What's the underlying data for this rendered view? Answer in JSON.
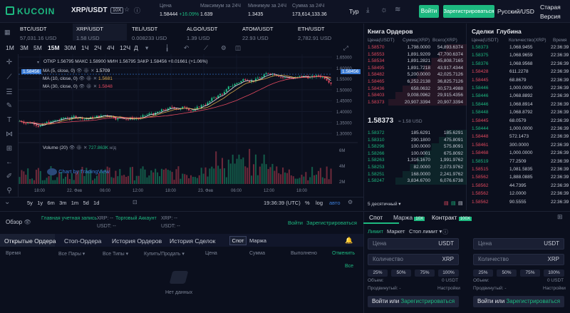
{
  "header": {
    "logo": "KUCOIN",
    "pair": "XRP/USDT",
    "leverage": "10X",
    "stats": [
      {
        "label": "Цена",
        "value": "1.58444",
        "change": "+16.09%"
      },
      {
        "label": "Максимум за 24Ч",
        "value": "1.639"
      },
      {
        "label": "Минимум за 24Ч",
        "value": "1.3435"
      },
      {
        "label": "Сумма за 24Ч",
        "value": "173,614,133.36"
      }
    ],
    "tur": "Тур",
    "login": "Войти",
    "register": "Зарегистрироваться",
    "lang": "Русский/USD",
    "old_version_1": "Старая",
    "old_version_2": "Версия"
  },
  "tickers": [
    {
      "name": "BTC/USDT",
      "price": "57,031.16 USD"
    },
    {
      "name": "XRP/USDT",
      "price": "1.58 USD"
    },
    {
      "name": "TEL/USDT",
      "price": "0.008233 USD"
    },
    {
      "name": "ALGO/USDT",
      "price": "1.39 USD"
    },
    {
      "name": "ATOM/USDT",
      "price": "22.93 USD"
    },
    {
      "name": "ETH/USDT",
      "price": "2,782.91 USD"
    }
  ],
  "timeframes": [
    "1M",
    "3M",
    "5M",
    "15M",
    "30M",
    "1Ч",
    "2Ч",
    "4Ч",
    "12Ч",
    "Д"
  ],
  "chart": {
    "ohlc": "ОТКР 1.56795   МАКС 1.58900   МИН 1.56795   ЗАКР 1.58456   +0.01661 (+1.06%)",
    "ma5": "MA (5, close, 0)",
    "ma5_val": "1.5709",
    "ma10": "MA (10, close, 0)",
    "ma10_val": "1.5681",
    "ma30": "MA (30, close, 0)",
    "ma30_val": "1.5848",
    "volume": "Volume (20)",
    "volume_val": "727.863K",
    "volume_na": "н/д",
    "price_tag": "1.58456",
    "watermark": "Chart by TradingView",
    "yticks": [
      "1.65000",
      "1.60000",
      "1.55000",
      "1.50000",
      "1.45000",
      "1.40000",
      "1.35000",
      "1.30000"
    ],
    "vticks": [
      "6M",
      "4M",
      "2M"
    ],
    "xticks": [
      "18:00",
      "22. Фев",
      "06:00",
      "12:00",
      "18:00",
      "23. Фев",
      "06:00",
      "12:00",
      "18:00"
    ],
    "ranges": [
      "5y",
      "1y",
      "6m",
      "3m",
      "1m",
      "5d",
      "1d"
    ],
    "time": "19:36:39 (UTC)",
    "pct": "%",
    "log": "log",
    "auto": "авто"
  },
  "orderbook": {
    "title": "Книга Ордеров",
    "headers": [
      "Цена(USDT)",
      "Сумма(XRP)",
      "Всего(XRP)"
    ],
    "asks": [
      [
        "1.58570",
        "1,798.0000",
        "54,893.6374"
      ],
      [
        "1.58553",
        "1,891.9209",
        "47,700.6374"
      ],
      [
        "1.58534",
        "1,891.2821",
        "45,808.7165"
      ],
      [
        "1.58495",
        "1,891.7218",
        "43,917.4344"
      ],
      [
        "1.58482",
        "5,200.0000",
        "42,025.7126"
      ],
      [
        "1.58465",
        "6,252.2138",
        "36,825.7126"
      ],
      [
        "1.58436",
        "658.0632",
        "30,573.4988"
      ],
      [
        "1.58403",
        "9,008.0962",
        "29,915.4356"
      ],
      [
        "1.58373",
        "20,907.3394",
        "20,907.3394"
      ]
    ],
    "last": "1.58373",
    "last_usd": "≈ 1.58 USD",
    "bids": [
      [
        "1.58372",
        "185.6291",
        "185.6291"
      ],
      [
        "1.58310",
        "290.1800",
        "475.8091"
      ],
      [
        "1.58296",
        "100.0000",
        "575.8091"
      ],
      [
        "1.58266",
        "100.0001",
        "675.8092"
      ],
      [
        "1.58263",
        "1,316.1670",
        "1,991.9762"
      ],
      [
        "1.58253",
        "82.0000",
        "2,073.9762"
      ],
      [
        "1.58251",
        "168.0000",
        "2,241.9762"
      ],
      [
        "1.58247",
        "3,834.6700",
        "6,076.6738"
      ]
    ],
    "decimals": "5 десятичный"
  },
  "trades": {
    "tab1": "Сделки",
    "tab2": "Глубина",
    "headers": [
      "Цена(USDT)",
      "Количество(XRP)",
      "Время"
    ],
    "rows": [
      [
        "1.58373",
        "1,068.9455",
        "22:36:39",
        "g"
      ],
      [
        "1.58375",
        "1,068.9659",
        "22:36:39",
        "g"
      ],
      [
        "1.58376",
        "1,068.9568",
        "22:36:39",
        "g"
      ],
      [
        "1.58428",
        "611.2278",
        "22:36:39",
        "r"
      ],
      [
        "1.58445",
        "68.8679",
        "22:36:39",
        "r"
      ],
      [
        "1.58446",
        "1,000.0000",
        "22:36:39",
        "g"
      ],
      [
        "1.58446",
        "1,068.8892",
        "22:36:39",
        "g"
      ],
      [
        "1.58446",
        "1,068.8914",
        "22:36:39",
        "g"
      ],
      [
        "1.58448",
        "1,068.8792",
        "22:36:39",
        "g"
      ],
      [
        "1.58445",
        "68.0579",
        "22:36:39",
        "r"
      ],
      [
        "1.58444",
        "1,000.0000",
        "22:36:39",
        "g"
      ],
      [
        "1.58448",
        "572.1473",
        "22:36:39",
        "r"
      ],
      [
        "1.58461",
        "300.0000",
        "22:36:39",
        "r"
      ],
      [
        "1.58468",
        "1,000.0000",
        "22:36:39",
        "r"
      ],
      [
        "1.58519",
        "77.2509",
        "22:36:39",
        "g"
      ],
      [
        "1.58515",
        "1,081.5835",
        "22:36:39",
        "r"
      ],
      [
        "1.58562",
        "1,888.0885",
        "22:36:39",
        "r"
      ],
      [
        "1.58562",
        "44.7395",
        "22:36:39",
        "r"
      ],
      [
        "1.58562",
        "12.0000",
        "22:36:39",
        "r"
      ],
      [
        "1.58562",
        "90.5555",
        "22:36:39",
        "r"
      ]
    ]
  },
  "overview": {
    "label": "Обзор",
    "main_account": "Главная учетная запись",
    "trade_account": "Торговый Аккаунт",
    "xrp1": "XRP: --",
    "usdt1": "USDT: --",
    "xrp2": "XRP: --",
    "usdt2": "USDT: --",
    "login": "Войти",
    "register": "Зарегистрироваться"
  },
  "orders": {
    "tabs": [
      "Открытые Ордера",
      "Стоп-Ордера",
      "История Ордеров",
      "История Сделок"
    ],
    "spot": "Спот",
    "margin": "Маржа",
    "cols": [
      "Время",
      "Все Пары",
      "Все Типы",
      "Купить/Продать",
      "Цена",
      "Сумма",
      "Выполнено",
      "Отменить"
    ],
    "all": "Все",
    "empty": "Нет данных"
  },
  "tradepanel": {
    "tabs": [
      "Спот",
      "Маржа",
      "Контракт"
    ],
    "margin_badge": "10X",
    "contract_badge": "100X",
    "types": [
      "Лимит",
      "Маркет",
      "Стоп лимит"
    ],
    "price": "Цена",
    "qty": "Количество",
    "usdt": "USDT",
    "xrp": "XRP",
    "pcts": [
      "25%",
      "50%",
      "75%",
      "100%"
    ],
    "volume_label": "Объем:",
    "volume_val": "0 USDT",
    "advanced": "Продвинутый: -",
    "settings": "Настройки",
    "btn_login": "Войти",
    "btn_or": "или",
    "btn_reg": "Зарегистрироваться"
  }
}
